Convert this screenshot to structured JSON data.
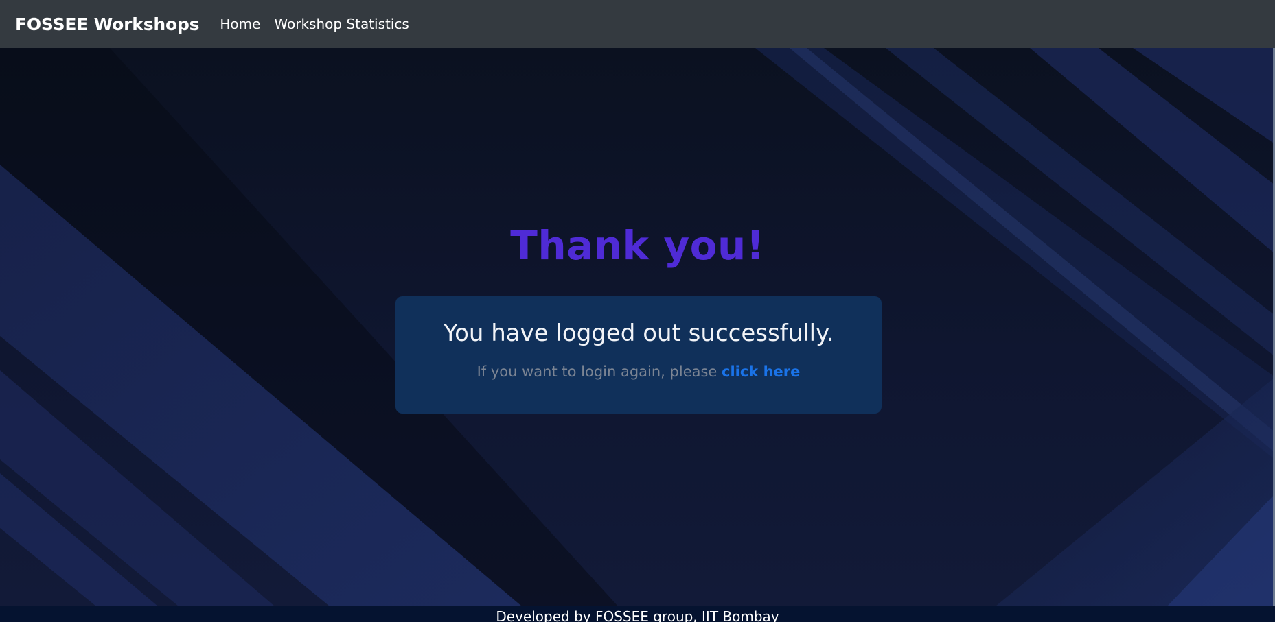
{
  "navbar": {
    "brand": "FOSSEE Workshops",
    "links": [
      "Home",
      "Workshop Statistics"
    ]
  },
  "main": {
    "title": "Thank you!",
    "message": "You have logged out successfully.",
    "login_prompt": "If you want to login again, please ",
    "login_link": "click here"
  },
  "footer": {
    "text": "Developed by FOSSEE group, IIT Bombay"
  },
  "colors": {
    "navbar": "#343a40",
    "title": "#4f2bd6",
    "card": "#10305a",
    "link": "#1a73e8",
    "footer": "#051330"
  }
}
